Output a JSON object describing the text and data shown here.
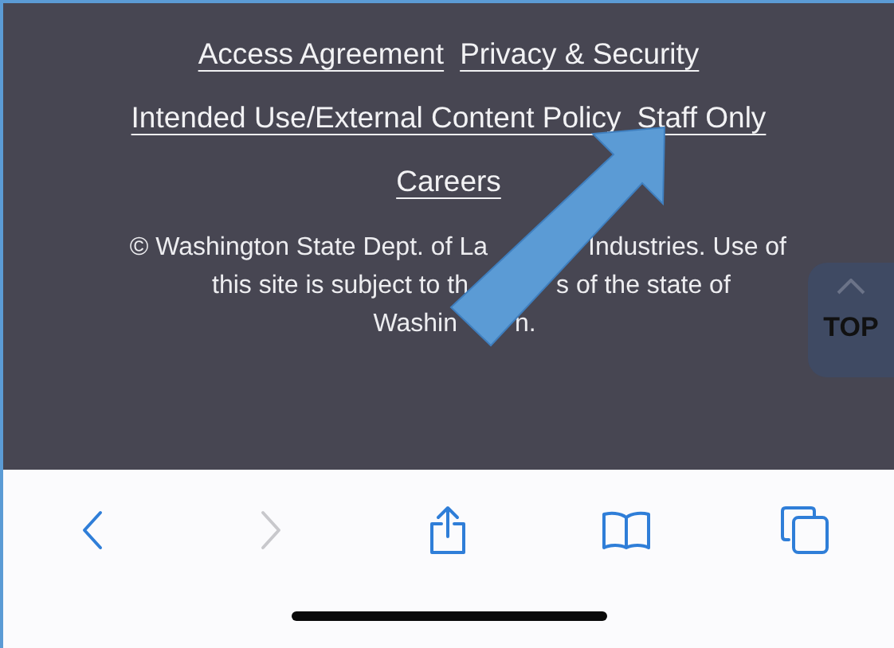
{
  "footer": {
    "link_rows": [
      {
        "links": [
          {
            "label": "Access Agreement"
          },
          {
            "label": "Privacy & Security"
          }
        ]
      },
      {
        "links": [
          {
            "label": "Intended Use/External Content Policy"
          },
          {
            "label": "Staff Only"
          }
        ]
      },
      {
        "links": [
          {
            "label": "Careers"
          }
        ]
      }
    ],
    "copyright_lines": [
      {
        "before": "© Washington State Dept. of La",
        "after": "Industries. Use of"
      },
      {
        "before": "this site is subject to th",
        "after": "s of the state of"
      },
      {
        "before": "Washin",
        "after": "n."
      }
    ]
  },
  "back_to_top": {
    "label": "TOP"
  },
  "toolbar": {
    "buttons": [
      {
        "kind": "back",
        "disabled": false
      },
      {
        "kind": "forward",
        "disabled": true
      },
      {
        "kind": "share",
        "disabled": false
      },
      {
        "kind": "bookmarks",
        "disabled": false
      },
      {
        "kind": "tabs",
        "disabled": false
      }
    ]
  }
}
